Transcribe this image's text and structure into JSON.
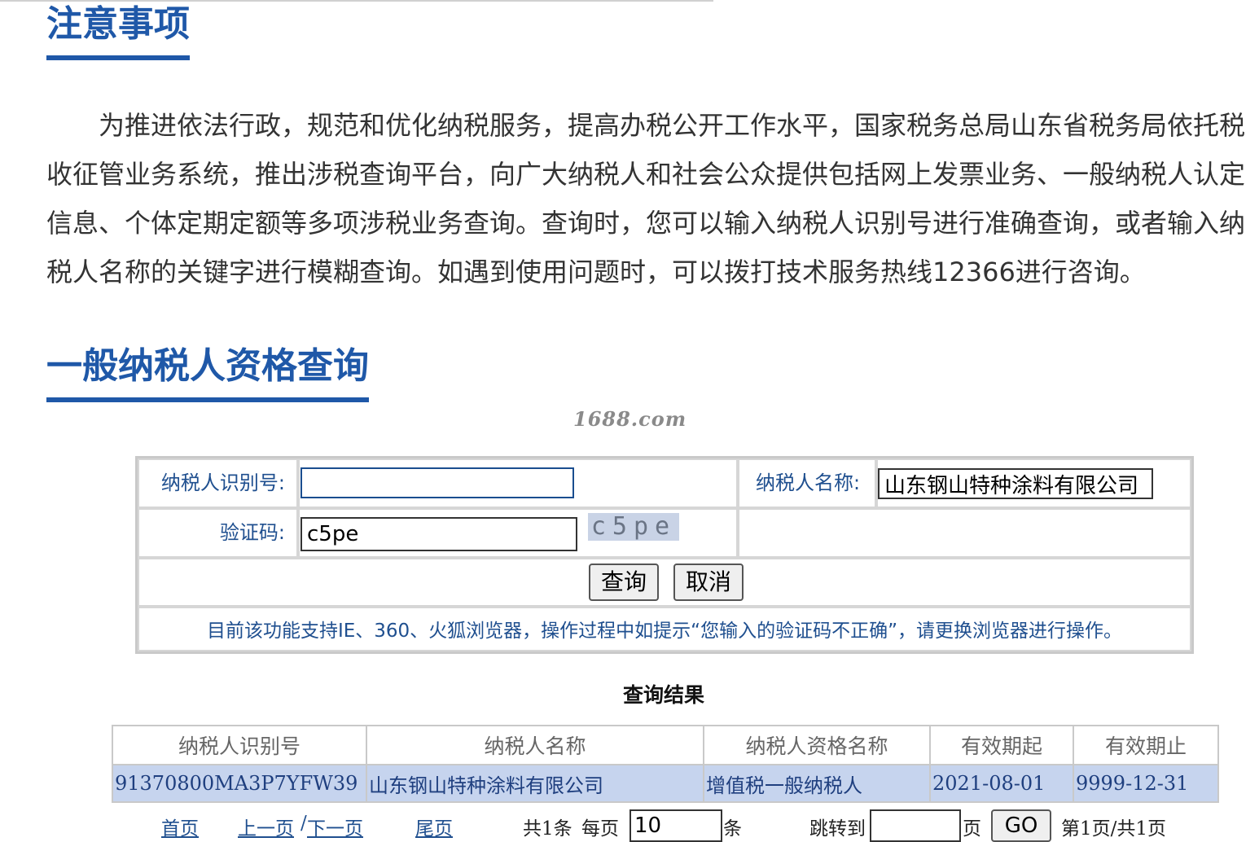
{
  "notice": {
    "title": "注意事项",
    "text": "为推进依法行政，规范和优化纳税服务，提高办税公开工作水平，国家税务总局山东省税务局依托税收征管业务系统，推出涉税查询平台，向广大纳税人和社会公众提供包括网上发票业务、一般纳税人认定信息、个体定期定额等多项涉税业务查询。查询时，您可以输入纳税人识别号进行准确查询，或者输入纳税人名称的关键字进行模糊查询。如遇到使用问题时，可以拨打技术服务热线12366进行咨询。"
  },
  "query_section": {
    "title": "一般纳税人资格查询",
    "watermark": "1688.com"
  },
  "form": {
    "taxpayer_id_label": "纳税人识别号:",
    "taxpayer_id_value": "",
    "taxpayer_name_label": "纳税人名称:",
    "taxpayer_name_value": "山东钢山特种涂料有限公司",
    "captcha_label": "验证码:",
    "captcha_value": "c5pe",
    "captcha_image_text": "c5pe",
    "query_button": "查询",
    "cancel_button": "取消",
    "browser_note": "目前该功能支持IE、360、火狐浏览器，操作过程中如提示“您输入的验证码不正确”，请更换浏览器进行操作。"
  },
  "results": {
    "caption": "查询结果",
    "columns": [
      "纳税人识别号",
      "纳税人名称",
      "纳税人资格名称",
      "有效期起",
      "有效期止"
    ],
    "rows": [
      [
        "91370800MA3P7YFW39",
        "山东钢山特种涂料有限公司",
        "增值税一般纳税人",
        "2021-08-01",
        "9999-12-31"
      ]
    ]
  },
  "pager": {
    "first": "首页",
    "prev": "上一页",
    "separator": "/",
    "next": "下一页",
    "last": "尾页",
    "total": "共1条",
    "per_page_label": "每页",
    "per_page_value": "10",
    "per_page_unit": "条",
    "jump_label": "跳转到",
    "jump_value": "",
    "page_unit": "页",
    "go_button": "GO",
    "page_info": "第1页/共1页"
  },
  "colors": {
    "accent": "#1f58a8",
    "label_text": "#1f4f8f",
    "result_row_bg": "#c6d4ee"
  }
}
